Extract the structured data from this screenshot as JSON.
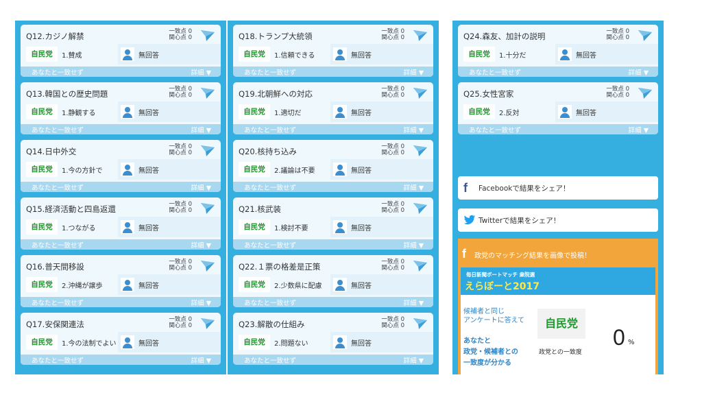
{
  "labels": {
    "points_line1": "一致点 0",
    "points_line2": "関心点 0",
    "party": "自民党",
    "candidate_answer": "無回答",
    "mismatch": "あなたと一致せず",
    "details": "詳細 ▼"
  },
  "col1": {
    "cards": [
      {
        "q": "Q12.カジノ解禁",
        "answer": "1.賛成"
      },
      {
        "q": "Q13.韓国との歴史問題",
        "answer": "1.静観する"
      },
      {
        "q": "Q14.日中外交",
        "answer": "1.今の方針で"
      },
      {
        "q": "Q15.経済活動と四島返還",
        "answer": "1.つながる"
      },
      {
        "q": "Q16.普天間移設",
        "answer": "2.沖縄が譲歩"
      },
      {
        "q": "Q17.安保関連法",
        "answer": "1.今の法制でよい"
      }
    ]
  },
  "col2": {
    "cards": [
      {
        "q": "Q18.トランプ大統領",
        "answer": "1.信頼できる"
      },
      {
        "q": "Q19.北朝鮮への対応",
        "answer": "1.適切だ"
      },
      {
        "q": "Q20.核持ち込み",
        "answer": "2.議論は不要"
      },
      {
        "q": "Q21.核武装",
        "answer": "1.検討不要"
      },
      {
        "q": "Q22.１票の格差是正策",
        "answer": "2.少数県に配慮"
      },
      {
        "q": "Q23.解散の仕組み",
        "answer": "2.問題ない"
      }
    ]
  },
  "col3": {
    "cards": [
      {
        "q": "Q24.森友、加計の説明",
        "answer": "1.十分だ"
      },
      {
        "q": "Q25.女性宮家",
        "answer": "2.反対"
      }
    ],
    "share_facebook": "Facebookで結果をシェア！",
    "share_twitter": "Twitterで結果をシェア！",
    "promo_title": "政党のマッチング結果を画像で投稿！",
    "promo_banner_small": "毎日新聞ボートマッチ 衆院選",
    "promo_banner_big": "えらぼーと2017",
    "promo_text1_line1": "候補者と同じ",
    "promo_text1_line2": "アンケートに答えて",
    "promo_text2_line1": "あなたと",
    "promo_text2_line2": "政党・候補者との",
    "promo_text2_line3": "一致度が分かる",
    "promo_party": "自民党",
    "promo_party_label": "政党との一致度",
    "promo_percent": "0",
    "promo_percent_unit": "%"
  },
  "colors": {
    "column_bg": "#35aee0",
    "party_green": "#1a9b2a",
    "promo_orange": "#f2a53a"
  }
}
